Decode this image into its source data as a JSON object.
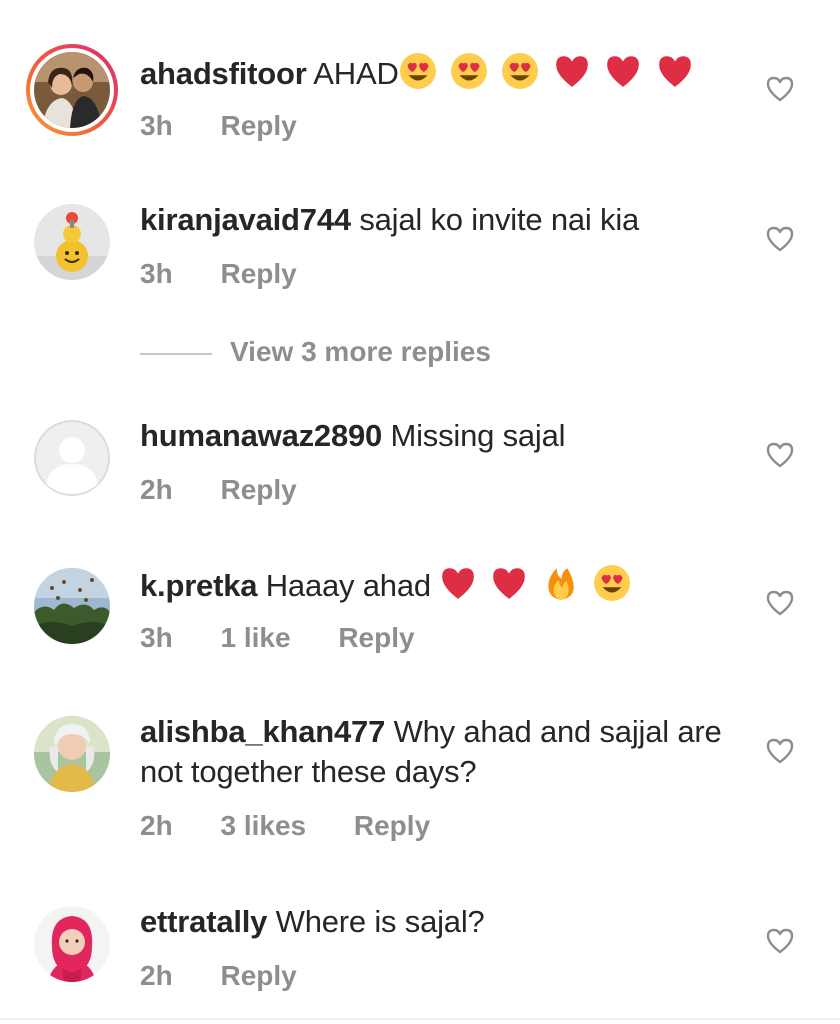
{
  "comments": [
    {
      "username": "ahadsfitoor",
      "text": "AHAD",
      "emojis": [
        "heart-eyes",
        "heart-eyes",
        "heart-eyes",
        "red-heart",
        "red-heart",
        "red-heart"
      ],
      "time": "3h",
      "likes": "",
      "reply": "Reply",
      "has_story": true
    },
    {
      "username": "kiranjavaid744",
      "text": "sajal ko invite nai kia",
      "time": "3h",
      "likes": "",
      "reply": "Reply"
    },
    {
      "username": "humanawaz2890",
      "text": "Missing sajal",
      "time": "2h",
      "likes": "",
      "reply": "Reply"
    },
    {
      "username": "k.pretka",
      "text": "Haaay ahad",
      "emojis": [
        "red-heart",
        "red-heart",
        "fire",
        "heart-eyes"
      ],
      "time": "3h",
      "likes": "1 like",
      "reply": "Reply"
    },
    {
      "username": "alishba_khan477",
      "text": "Why ahad and sajjal are not together these days?",
      "time": "2h",
      "likes": "3 likes",
      "reply": "Reply"
    },
    {
      "username": "ettratally",
      "text": "Where is sajal?",
      "time": "2h",
      "likes": "",
      "reply": "Reply"
    }
  ],
  "view_more_replies": "View 3 more replies",
  "icons": {
    "like": "heart-outline-icon"
  },
  "colors": {
    "text": "#262626",
    "secondary": "#8e8e8e",
    "story_ring_start": "#f9a13c",
    "story_ring_end": "#d62977"
  }
}
